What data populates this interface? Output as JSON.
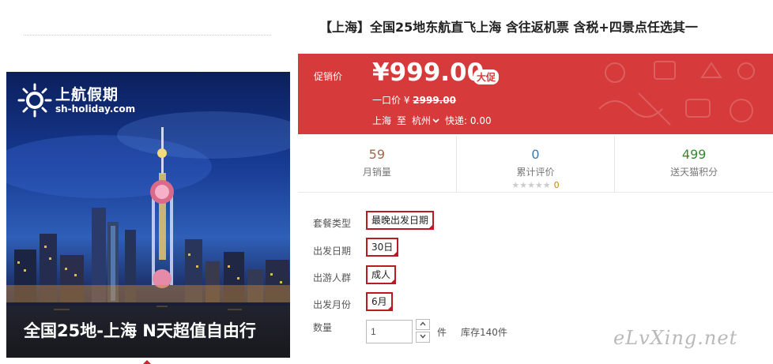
{
  "hero": {
    "logo_cn": "上航假期",
    "logo_url": "sh-holiday.com",
    "caption": "全国25地-上海 N天超值自由行"
  },
  "product": {
    "title": "【上海】全国25地东航直飞上海 含往返机票 含税+四景点任选其一"
  },
  "price": {
    "label": "促销价",
    "value": "¥999.00",
    "promo_tag": "大促",
    "original_label": "一口价 ¥",
    "original_value": "2999.00",
    "from_city": "上海",
    "to_word": "至",
    "dest_city": "杭州",
    "delivery": "快递: 0.00"
  },
  "stats": {
    "monthly_sales": "59",
    "monthly_sales_label": "月销量",
    "reviews": "0",
    "reviews_label": "累计评价",
    "stars": "★★★★★",
    "rating": "0",
    "points": "499",
    "points_label": "送天猫积分"
  },
  "options": {
    "package_label": "套餐类型",
    "package_value": "最晚出发日期",
    "date_label": "出发日期",
    "date_value": "30日",
    "group_label": "出游人群",
    "group_value": "成人",
    "month_label": "出发月份",
    "month_value": "6月",
    "qty_label": "数量",
    "qty_value": "1",
    "qty_unit": "件",
    "stock": "库存140件"
  },
  "watermark": "eLvXing.net",
  "colors": {
    "price_bg": "#d63a3a",
    "option_border": "#b81c22"
  }
}
